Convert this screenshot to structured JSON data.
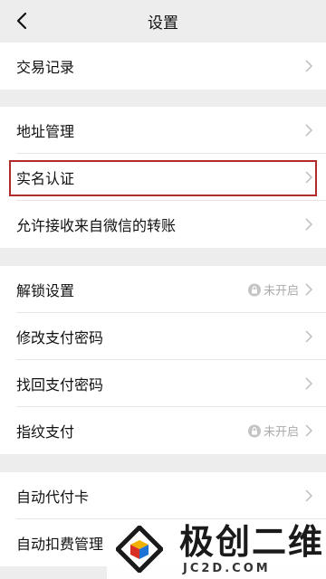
{
  "nav": {
    "title": "设置"
  },
  "groups": [
    {
      "items": [
        {
          "label": "交易记录"
        }
      ]
    },
    {
      "items": [
        {
          "label": "地址管理"
        },
        {
          "label": "实名认证"
        },
        {
          "label": "允许接收来自微信的转账"
        }
      ]
    },
    {
      "items": [
        {
          "label": "解锁设置",
          "status": "未开启"
        },
        {
          "label": "修改支付密码"
        },
        {
          "label": "找回支付密码"
        },
        {
          "label": "指纹支付",
          "status": "未开启"
        }
      ]
    },
    {
      "items": [
        {
          "label": "自动代付卡"
        },
        {
          "label": "自动扣费管理"
        }
      ]
    }
  ],
  "highlight_color": "#b22a2a",
  "watermark": {
    "title": "极创二维",
    "subtitle": "JC2D.COM"
  }
}
